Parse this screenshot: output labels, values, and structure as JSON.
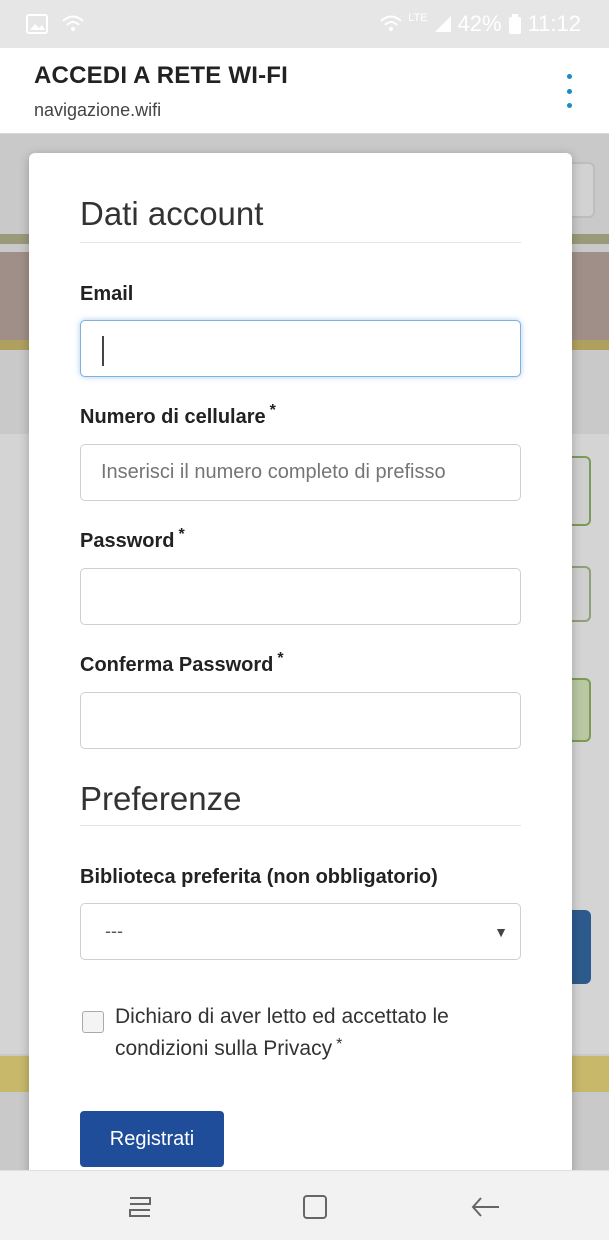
{
  "status_bar": {
    "left_icons": [
      "image-icon",
      "wifi-outline-icon"
    ],
    "network": "LTE",
    "battery": "42%",
    "time": "11:12"
  },
  "browser": {
    "title": "ACCEDI A RETE WI-FI",
    "url": "navigazione.wifi"
  },
  "form": {
    "account_section": "Dati account",
    "email_label": "Email",
    "email_value": "",
    "phone_label": "Numero di cellulare",
    "phone_placeholder": "Inserisci il numero completo di prefisso",
    "password_label": "Password",
    "confirm_label": "Conferma Password",
    "required_marker": "*",
    "preferences_section": "Preferenze",
    "library_label": "Biblioteca preferita (non obbligatorio)",
    "library_selected": "---",
    "privacy_label": "Dichiaro di aver letto ed accettato le condizioni sulla Privacy",
    "privacy_checked": false,
    "submit_label": "Registrati"
  },
  "colors": {
    "accent": "#1f4d99",
    "menu_dots": "#1e88c9",
    "focus_border": "#7eb0e0"
  }
}
